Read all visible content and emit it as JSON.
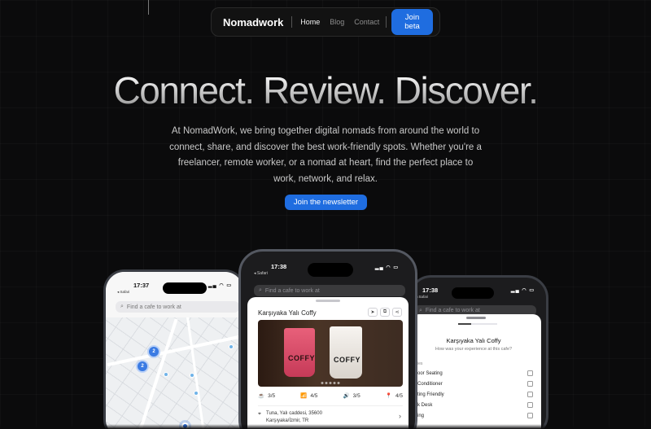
{
  "nav": {
    "brand": "Nomadwork",
    "links": [
      "Home",
      "Blog",
      "Contact"
    ],
    "cta": "Join beta"
  },
  "hero": {
    "title": "Connect. Review. Discover.",
    "description": "At NomadWork, we bring together digital nomads from around the world to connect, share, and discover the best work-friendly spots. Whether you're a freelancer, remote worker, or a nomad at heart, find the perfect place to work, network, and relax.",
    "cta": "Join the newsletter"
  },
  "phone_left": {
    "time": "17:37",
    "back": "◂ Safari",
    "search_placeholder": "Find a cafe to work at",
    "clusters": [
      "2",
      "2"
    ]
  },
  "phone_middle": {
    "time": "17:38",
    "back": "◂ Safari",
    "search_placeholder": "Find a cafe to work at",
    "cafe_name": "Karşıyaka Yalı Coffy",
    "cup_label_1": "COFFY",
    "cup_label_2": "COFFY",
    "ratings": [
      {
        "icon": "☕",
        "value": "3/5"
      },
      {
        "icon": "📶",
        "value": "4/5"
      },
      {
        "icon": "🔊",
        "value": "3/5"
      },
      {
        "icon": "📍",
        "value": "4/5"
      }
    ],
    "address_line1": "Tuna, Yalı caddesi, 35600",
    "address_line2": "Karşıyaka/İzmir, TR"
  },
  "phone_right": {
    "time": "17:38",
    "back": "◂ Safari",
    "search_placeholder": "Find a cafe to work at",
    "title": "Karşıyaka Yalı Coffy",
    "subtitle": "How was your experience at this cafe?",
    "section": "ies",
    "amenities": [
      "oor Seating",
      "Conditioner",
      "ting Friendly",
      "k Desk",
      "ing"
    ]
  },
  "colors": {
    "accent": "#1f6de0",
    "background": "#0b0b0c"
  }
}
